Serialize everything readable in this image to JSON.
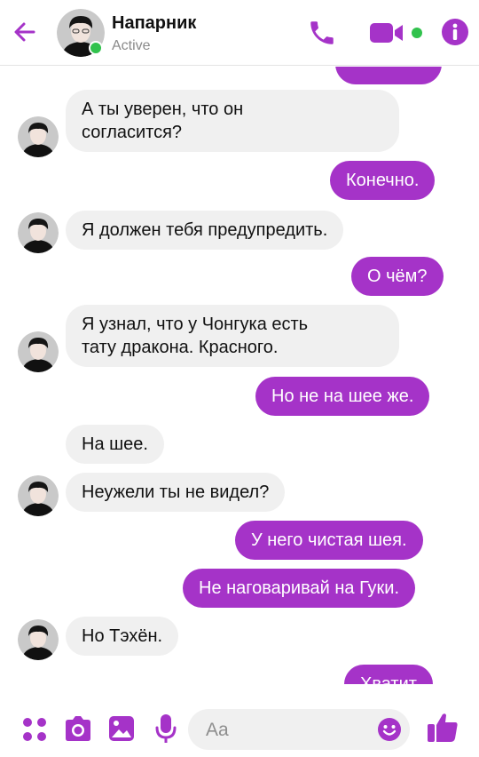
{
  "header": {
    "contact_name": "Напарник",
    "status": "Active",
    "accent_color": "#a533c8",
    "online_color": "#31c24d"
  },
  "messages": [
    {
      "from": "me",
      "text": ""
    },
    {
      "from": "them",
      "text": "А ты уверен, что он\nсогласится?"
    },
    {
      "from": "me",
      "text": "Конечно."
    },
    {
      "from": "them",
      "text": "Я должен тебя предупредить."
    },
    {
      "from": "me",
      "text": "О чём?"
    },
    {
      "from": "them",
      "text": "Я узнал, что у Чонгука есть\nтату дракона. Красного."
    },
    {
      "from": "me",
      "text": "Но не на шее же."
    },
    {
      "from": "them",
      "text": "На шее."
    },
    {
      "from": "them",
      "text": "Неужели ты не видел?"
    },
    {
      "from": "me",
      "text": "У него чистая шея."
    },
    {
      "from": "me",
      "text": "Не наговаривай на Гуки."
    },
    {
      "from": "them",
      "text": "Но Тэхён."
    },
    {
      "from": "me",
      "text": "Хватит"
    }
  ],
  "composer": {
    "placeholder": "Aa",
    "icons": [
      "apps-icon",
      "camera-icon",
      "gallery-icon",
      "microphone-icon",
      "emoji-icon",
      "thumbs-up-icon"
    ]
  }
}
